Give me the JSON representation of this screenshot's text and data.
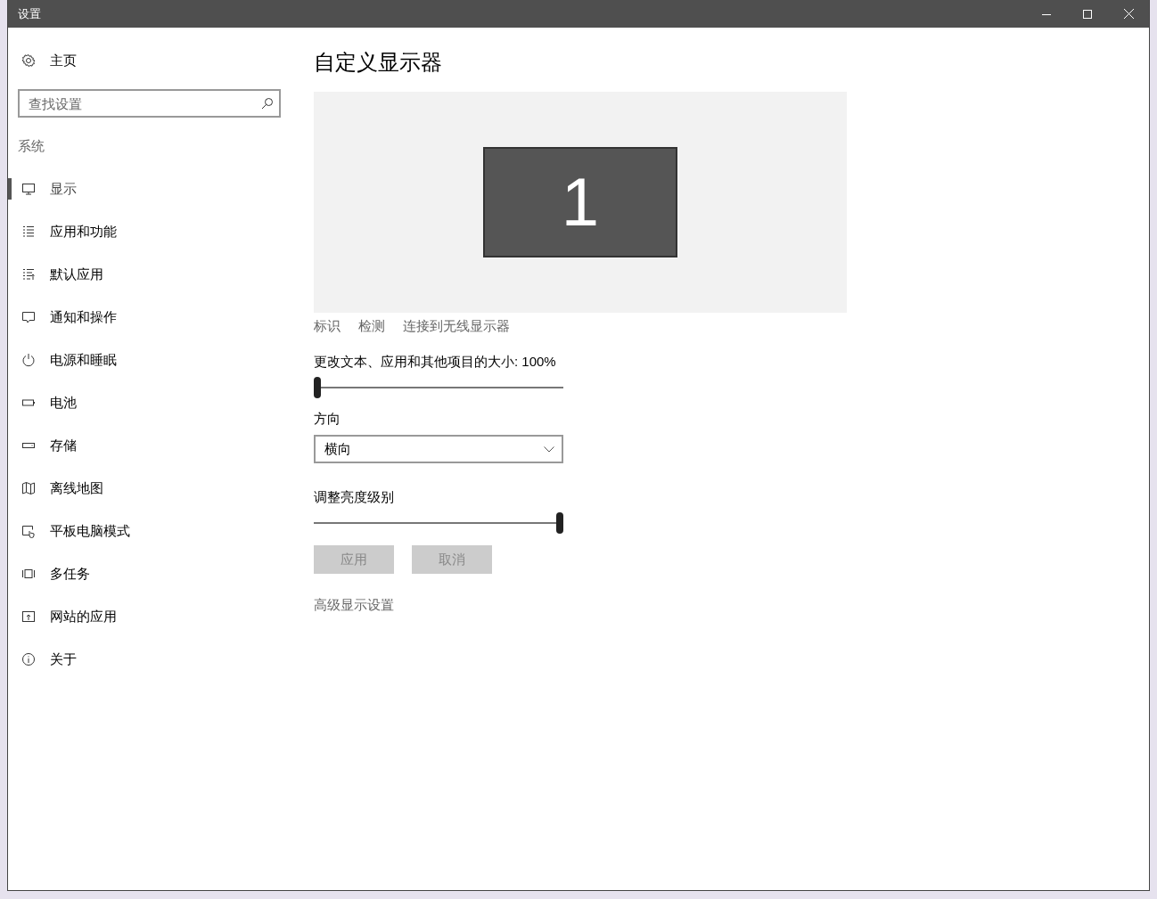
{
  "window": {
    "title": "设置"
  },
  "sidebar": {
    "home": "主页",
    "search": {
      "placeholder": "查找设置"
    },
    "section": "系统",
    "items": [
      {
        "label": "显示",
        "selected": true
      },
      {
        "label": "应用和功能",
        "selected": false
      },
      {
        "label": "默认应用",
        "selected": false
      },
      {
        "label": "通知和操作",
        "selected": false
      },
      {
        "label": "电源和睡眠",
        "selected": false
      },
      {
        "label": "电池",
        "selected": false
      },
      {
        "label": "存储",
        "selected": false
      },
      {
        "label": "离线地图",
        "selected": false
      },
      {
        "label": "平板电脑模式",
        "selected": false
      },
      {
        "label": "多任务",
        "selected": false
      },
      {
        "label": "网站的应用",
        "selected": false
      },
      {
        "label": "关于",
        "selected": false
      }
    ]
  },
  "content": {
    "title": "自定义显示器",
    "monitor_label": "1",
    "links": [
      "标识",
      "检测",
      "连接到无线显示器"
    ],
    "scale": {
      "label": "更改文本、应用和其他项目的大小: 100%",
      "level": 0
    },
    "orientation": {
      "label": "方向",
      "value": "横向"
    },
    "brightness": {
      "label": "调整亮度级别",
      "level": 1
    },
    "buttons": [
      {
        "label": "应用",
        "disabled": true
      },
      {
        "label": "取消",
        "disabled": true
      }
    ],
    "advanced_link": "高级显示设置"
  }
}
